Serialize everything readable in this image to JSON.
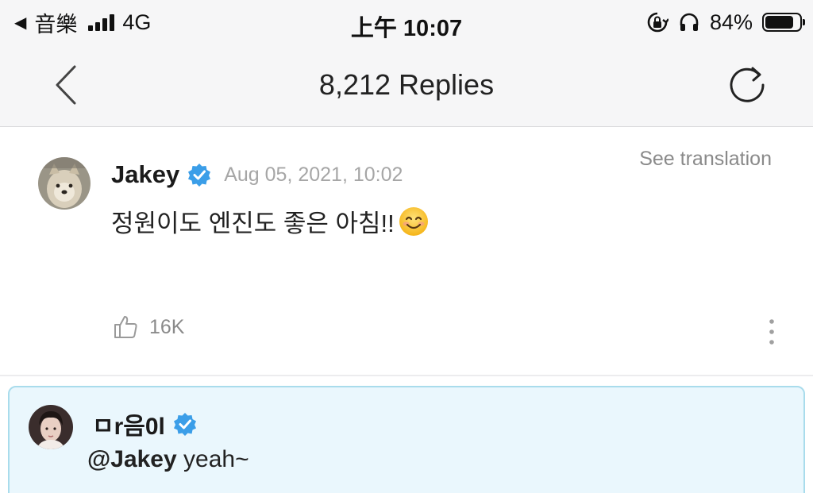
{
  "status_bar": {
    "back_app": "音樂",
    "network": "4G",
    "time": "上午 10:07",
    "battery": "84%",
    "battery_level": 0.84
  },
  "nav": {
    "title": "8,212 Replies",
    "back_icon": "chevron-left-icon",
    "refresh_icon": "refresh-icon"
  },
  "post": {
    "author": "Jakey",
    "verified": true,
    "date": "Aug 05, 2021, 10:02",
    "see_translation": "See translation",
    "text": "정원이도 엔진도 좋은 아침!!",
    "emoji": "😊",
    "likes": "16K"
  },
  "reply": {
    "author": "ㅁr음0l",
    "verified": true,
    "mention": "@Jakey",
    "text": " yeah~"
  },
  "colors": {
    "verified_blue": "#3b9ee8",
    "reply_bg": "#eaf7fd",
    "reply_border": "#a9dcec"
  }
}
